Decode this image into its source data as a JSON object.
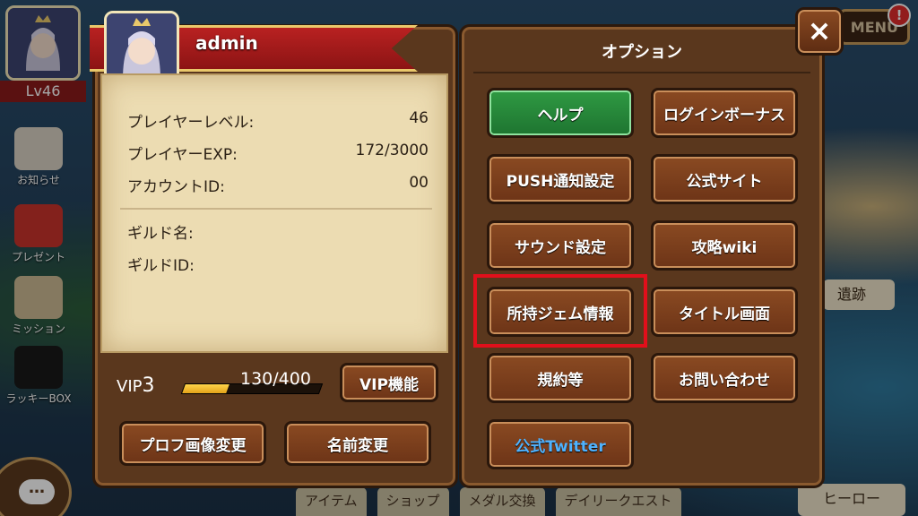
{
  "hud": {
    "level": "Lv46",
    "menu_label": "MENU",
    "alert_badge": "!",
    "side_menu": [
      {
        "label": "お知らせ"
      },
      {
        "label": "プレゼント"
      },
      {
        "label": "ミッション"
      },
      {
        "label": "ラッキーBOX"
      }
    ],
    "bottom_tabs": [
      "アイテム",
      "ショップ",
      "メダル交換",
      "デイリークエスト"
    ],
    "hero_tab": "ヒーロー",
    "ruins_label": "遺跡",
    "chat_icon": "…"
  },
  "profile": {
    "name": "admin",
    "rows": [
      {
        "label": "プレイヤーレベル:",
        "value": "46"
      },
      {
        "label": "プレイヤーEXP:",
        "value": "172/3000"
      },
      {
        "label": "アカウントID:",
        "value": "00"
      },
      {
        "label": "ギルド名:",
        "value": ""
      },
      {
        "label": "ギルドID:",
        "value": ""
      }
    ],
    "vip_label": "VIP",
    "vip_level": "3",
    "vip_progress": "130/400",
    "vip_fraction": 0.325,
    "vip_button": "VIP機能",
    "change_image_button": "プロフ画像変更",
    "change_name_button": "名前変更"
  },
  "options": {
    "title": "オプション",
    "close_icon": "×",
    "buttons": [
      {
        "label": "ヘルプ"
      },
      {
        "label": "ログインボーナス"
      },
      {
        "label": "PUSH通知設定"
      },
      {
        "label": "公式サイト"
      },
      {
        "label": "サウンド設定"
      },
      {
        "label": "攻略wiki"
      },
      {
        "label": "所持ジェム情報"
      },
      {
        "label": "タイトル画面"
      },
      {
        "label": "規約等"
      },
      {
        "label": "お問い合わせ"
      },
      {
        "label": "公式Twitter"
      }
    ]
  },
  "colors": {
    "highlight": "#e10f1b",
    "help_button": "#2f9a43",
    "twitter_text": "#4fb3ff"
  }
}
